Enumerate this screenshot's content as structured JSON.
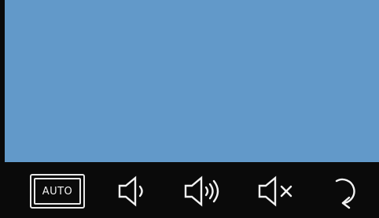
{
  "display": {
    "background_color": "#6299c9"
  },
  "toolbar": {
    "auto_label": "AUTO",
    "icons": {
      "auto": "auto-icon",
      "volume_low": "volume-low-icon",
      "volume_high": "volume-high-icon",
      "mute": "mute-icon",
      "rotate": "rotate-icon"
    },
    "foreground_color": "#f2f2f2",
    "background_color": "#0a0a0a"
  }
}
